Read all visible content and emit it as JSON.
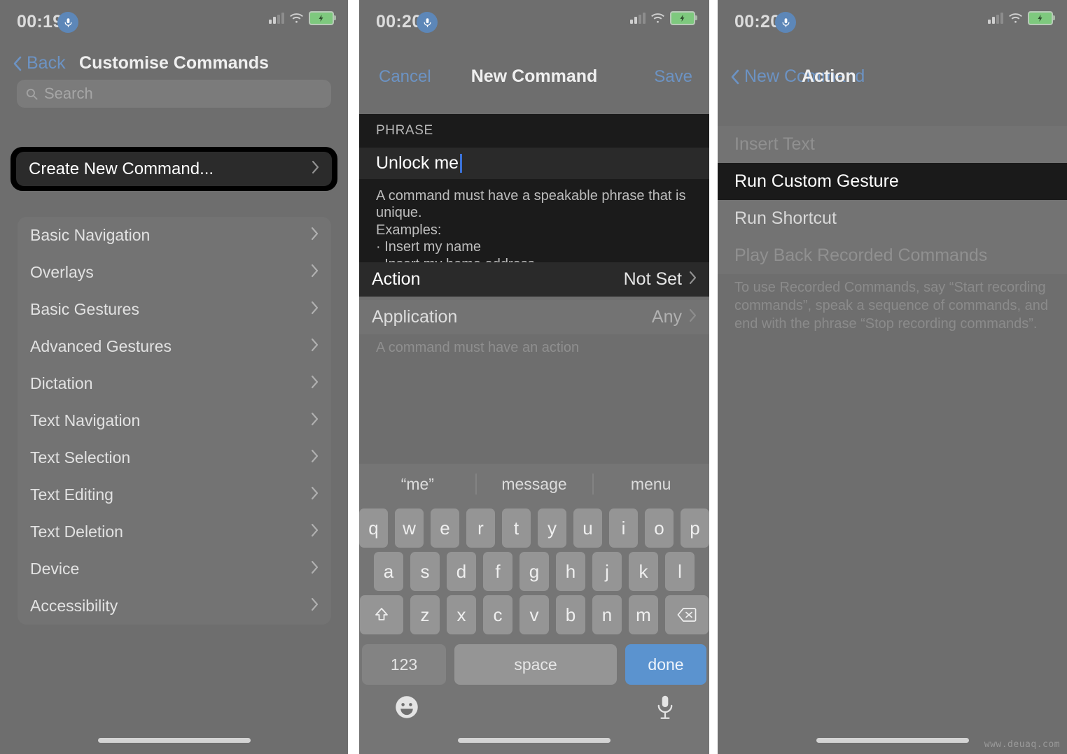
{
  "watermark": "www.deuaq.com",
  "icons": {
    "mic_badge": "microphone-badge-icon",
    "signal": "cellular-signal-icon",
    "wifi": "wifi-icon",
    "battery": "battery-charging-icon",
    "search": "search-icon",
    "chevron_right": "chevron-right-icon",
    "chevron_left": "chevron-left-icon",
    "shift": "shift-key-icon",
    "backspace": "backspace-key-icon",
    "emoji": "emoji-keyboard-icon",
    "dictation": "dictation-mic-icon",
    "home_indicator": "home-indicator"
  },
  "colors": {
    "accent_blue": "#6c93c4",
    "key_done_blue": "#5b93cf",
    "caret_blue": "#3b72d8",
    "battery_green": "#7ec97e",
    "panel_bg": "#6e6e6e",
    "sheet_bg": "#1b1b1b",
    "highlight_black": "#000000"
  },
  "panel1": {
    "status": {
      "time": "00:19"
    },
    "nav": {
      "back_label": "Back",
      "title": "Customise Commands"
    },
    "search": {
      "placeholder": "Search",
      "value": ""
    },
    "focused_item": {
      "label": "Create New Command...",
      "focused": true
    },
    "list_items": [
      {
        "label": "Basic Navigation"
      },
      {
        "label": "Overlays"
      },
      {
        "label": "Basic Gestures"
      },
      {
        "label": "Advanced Gestures"
      },
      {
        "label": "Dictation"
      },
      {
        "label": "Text Navigation"
      },
      {
        "label": "Text Selection"
      },
      {
        "label": "Text Editing"
      },
      {
        "label": "Text Deletion"
      },
      {
        "label": "Device"
      },
      {
        "label": "Accessibility"
      }
    ]
  },
  "panel2": {
    "status": {
      "time": "00:20"
    },
    "nav": {
      "cancel_label": "Cancel",
      "title": "New Command",
      "save_label": "Save"
    },
    "phrase_section": {
      "header": "PHRASE",
      "value": "Unlock me",
      "hint_line1": "A command must have a speakable phrase that is unique.",
      "hint_line2": "Examples:",
      "hint_bullet1": "· Insert my name",
      "hint_bullet2": "· Insert my home address"
    },
    "action_row": {
      "label": "Action",
      "value": "Not Set"
    },
    "application_row": {
      "label": "Application",
      "value": "Any"
    },
    "application_footer": "A command must have an action",
    "keyboard": {
      "suggestions": [
        "“me”",
        "message",
        "menu"
      ],
      "row1": [
        "q",
        "w",
        "e",
        "r",
        "t",
        "y",
        "u",
        "i",
        "o",
        "p"
      ],
      "row2": [
        "a",
        "s",
        "d",
        "f",
        "g",
        "h",
        "j",
        "k",
        "l"
      ],
      "row3": [
        "z",
        "x",
        "c",
        "v",
        "b",
        "n",
        "m"
      ],
      "numbers_key": "123",
      "space_key": "space",
      "return_key": "done"
    }
  },
  "panel3": {
    "status": {
      "time": "00:20"
    },
    "nav": {
      "back_label": "New Command",
      "title": "Action"
    },
    "options": [
      {
        "label": "Insert Text",
        "state": "dim"
      },
      {
        "label": "Run Custom Gesture",
        "state": "selected"
      },
      {
        "label": "Run Shortcut",
        "state": "plain"
      },
      {
        "label": "Play Back Recorded Commands",
        "state": "dim"
      }
    ],
    "footer": "To use Recorded Commands, say “Start recording commands”, speak a sequence of commands, and end with the phrase “Stop recording commands”."
  }
}
